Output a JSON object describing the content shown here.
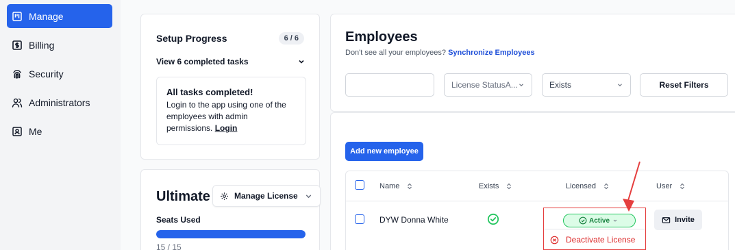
{
  "sidebar": {
    "items": [
      {
        "label": "Manage",
        "icon": "board-icon",
        "active": true
      },
      {
        "label": "Billing",
        "icon": "dollar-icon",
        "active": false
      },
      {
        "label": "Security",
        "icon": "fingerprint-icon",
        "active": false
      },
      {
        "label": "Administrators",
        "icon": "users-icon",
        "active": false
      },
      {
        "label": "Me",
        "icon": "id-badge-icon",
        "active": false
      }
    ]
  },
  "setup": {
    "title": "Setup Progress",
    "badge": "6 / 6",
    "view_tasks": "View 6 completed tasks",
    "done_title": "All tasks completed!",
    "done_text": "Login to the app using one of the employees with admin permissions.",
    "login_link": "Login"
  },
  "license": {
    "title": "Ultimate",
    "manage_button": "Manage License",
    "seats_label": "Seats Used",
    "seats_used": 15,
    "seats_total": 15,
    "seats_text": "15 / 15"
  },
  "employees": {
    "title": "Employees",
    "subtitle": "Don't see all your employees?",
    "sync_link": "Synchronize Employees",
    "filters": {
      "search_value": "",
      "license_status": "License StatusA...",
      "exists": "Exists",
      "reset": "Reset Filters"
    },
    "add_button": "Add new employee",
    "columns": {
      "name": "Name",
      "exists": "Exists",
      "licensed": "Licensed",
      "user": "User"
    },
    "rows": [
      {
        "name": "DYW Donna White",
        "exists": true,
        "licensed": "Active",
        "user_action": "Invite"
      }
    ],
    "license_menu": {
      "deactivate": "Deactivate License"
    }
  },
  "colors": {
    "accent": "#2563eb",
    "success": "#22c55e",
    "danger": "#dc2626",
    "annotation": "#e53e3e"
  }
}
